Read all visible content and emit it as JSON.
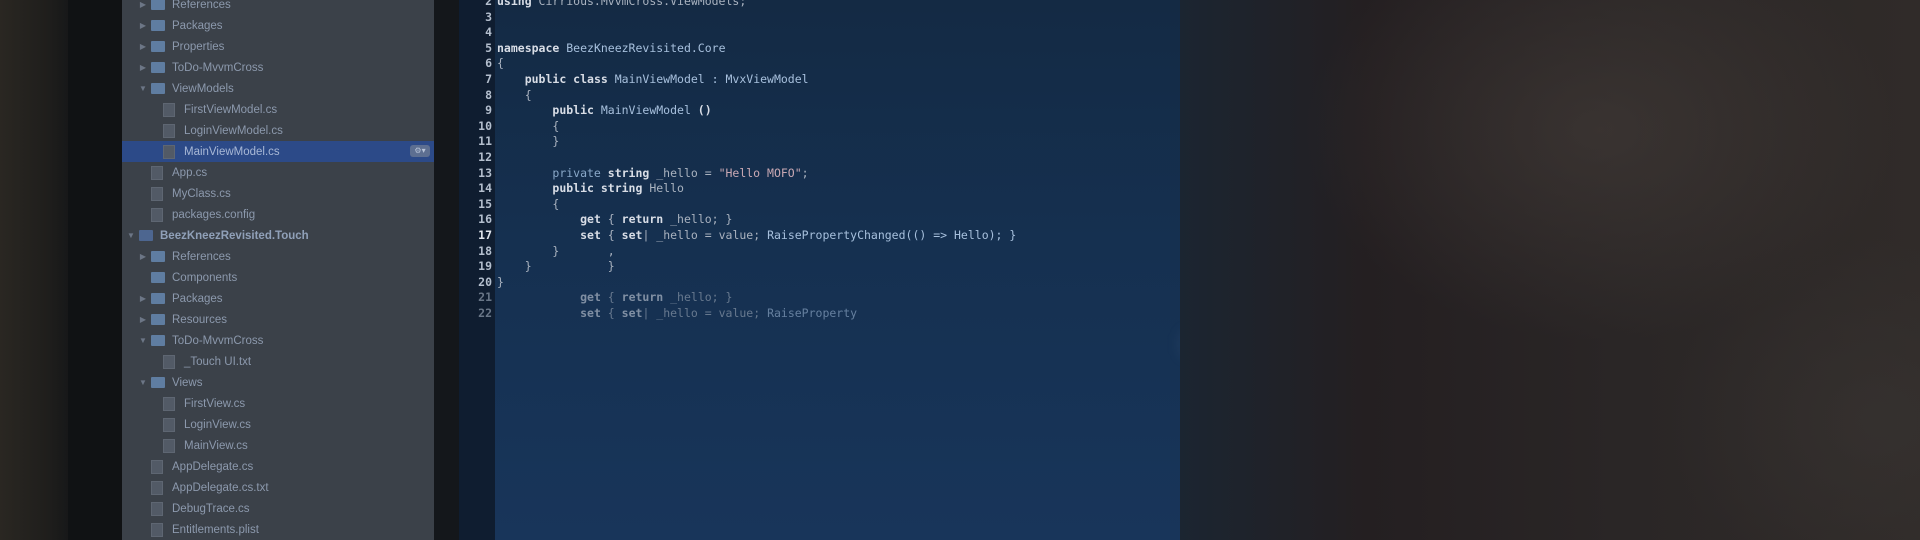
{
  "solution_explorer": {
    "items": [
      {
        "label": "References",
        "kind": "folder",
        "indent": 2,
        "arrow": "right"
      },
      {
        "label": "Packages",
        "kind": "folder",
        "indent": 2,
        "arrow": "right"
      },
      {
        "label": "Properties",
        "kind": "folder",
        "indent": 2,
        "arrow": "right"
      },
      {
        "label": "ToDo-MvvmCross",
        "kind": "folder",
        "indent": 2,
        "arrow": "right"
      },
      {
        "label": "ViewModels",
        "kind": "folder",
        "indent": 2,
        "arrow": "down"
      },
      {
        "label": "FirstViewModel.cs",
        "kind": "file",
        "indent": 3,
        "arrow": "none"
      },
      {
        "label": "LoginViewModel.cs",
        "kind": "file",
        "indent": 3,
        "arrow": "none"
      },
      {
        "label": "MainViewModel.cs",
        "kind": "file",
        "indent": 3,
        "arrow": "none",
        "selected": true
      },
      {
        "label": "App.cs",
        "kind": "file",
        "indent": 2,
        "arrow": "none"
      },
      {
        "label": "MyClass.cs",
        "kind": "file",
        "indent": 2,
        "arrow": "none"
      },
      {
        "label": "packages.config",
        "kind": "file",
        "indent": 2,
        "arrow": "none"
      },
      {
        "label": "BeezKneezRevisited.Touch",
        "kind": "project",
        "indent": 1,
        "arrow": "down"
      },
      {
        "label": "References",
        "kind": "folder",
        "indent": 2,
        "arrow": "right"
      },
      {
        "label": "Components",
        "kind": "folder",
        "indent": 2,
        "arrow": "none"
      },
      {
        "label": "Packages",
        "kind": "folder",
        "indent": 2,
        "arrow": "right"
      },
      {
        "label": "Resources",
        "kind": "folder",
        "indent": 2,
        "arrow": "right"
      },
      {
        "label": "ToDo-MvvmCross",
        "kind": "folder",
        "indent": 2,
        "arrow": "down"
      },
      {
        "label": "_Touch UI.txt",
        "kind": "file",
        "indent": 3,
        "arrow": "none"
      },
      {
        "label": "Views",
        "kind": "folder",
        "indent": 2,
        "arrow": "down"
      },
      {
        "label": "FirstView.cs",
        "kind": "file",
        "indent": 3,
        "arrow": "none"
      },
      {
        "label": "LoginView.cs",
        "kind": "file",
        "indent": 3,
        "arrow": "none"
      },
      {
        "label": "MainView.cs",
        "kind": "file",
        "indent": 3,
        "arrow": "none"
      },
      {
        "label": "AppDelegate.cs",
        "kind": "file",
        "indent": 2,
        "arrow": "none"
      },
      {
        "label": "AppDelegate.cs.txt",
        "kind": "file",
        "indent": 2,
        "arrow": "none"
      },
      {
        "label": "DebugTrace.cs",
        "kind": "file",
        "indent": 2,
        "arrow": "none"
      },
      {
        "label": "Entitlements.plist",
        "kind": "file",
        "indent": 2,
        "arrow": "none"
      }
    ],
    "selected_badge": "⚙▾"
  },
  "editor": {
    "lines": [
      {
        "n": "2",
        "segs": [
          [
            "k",
            "using "
          ],
          [
            "txt",
            "Cirrious.MvvmCross.ViewModels;"
          ]
        ]
      },
      {
        "n": "3",
        "segs": []
      },
      {
        "n": "4",
        "segs": []
      },
      {
        "n": "5",
        "segs": [
          [
            "k",
            "namespace "
          ],
          [
            "t",
            "BeezKneezRevisited.Core"
          ]
        ]
      },
      {
        "n": "6",
        "segs": [
          [
            "txt",
            "{"
          ]
        ]
      },
      {
        "n": "7",
        "segs": [
          [
            "txt",
            "    "
          ],
          [
            "k",
            "public class "
          ],
          [
            "t",
            "MainViewModel : MvxViewModel"
          ]
        ]
      },
      {
        "n": "8",
        "segs": [
          [
            "txt",
            "    {"
          ]
        ]
      },
      {
        "n": "9",
        "segs": [
          [
            "txt",
            "        "
          ],
          [
            "k",
            "public "
          ],
          [
            "t",
            "MainViewModel "
          ],
          [
            "k",
            "()"
          ]
        ]
      },
      {
        "n": "10",
        "segs": [
          [
            "txt",
            "        {"
          ]
        ]
      },
      {
        "n": "11",
        "segs": [
          [
            "txt",
            "        }"
          ]
        ]
      },
      {
        "n": "12",
        "segs": []
      },
      {
        "n": "13",
        "segs": [
          [
            "txt",
            "        "
          ],
          [
            "c",
            "private "
          ],
          [
            "k",
            "string "
          ],
          [
            "txt",
            "_hello = "
          ],
          [
            "s",
            "\"Hello MOFO\""
          ],
          [
            "txt",
            ";"
          ]
        ]
      },
      {
        "n": "14",
        "segs": [
          [
            "txt",
            "        "
          ],
          [
            "k",
            "public string "
          ],
          [
            "txt",
            "Hello"
          ]
        ]
      },
      {
        "n": "15",
        "segs": [
          [
            "txt",
            "        {"
          ]
        ]
      },
      {
        "n": "16",
        "segs": [
          [
            "txt",
            "            "
          ],
          [
            "k",
            "get "
          ],
          [
            "txt",
            "{ "
          ],
          [
            "k",
            "return "
          ],
          [
            "txt",
            "_hello; }"
          ]
        ]
      },
      {
        "n": "17",
        "hl": true,
        "segs": [
          [
            "txt",
            "            "
          ],
          [
            "k",
            "set "
          ],
          [
            "txt",
            "{ "
          ],
          [
            "k",
            "set"
          ],
          [
            "txt",
            "| _hello = value; "
          ],
          [
            "t",
            "RaisePropertyChanged(() => Hello); }"
          ]
        ]
      },
      {
        "n": "18",
        "segs": [
          [
            "txt",
            "        }       ,"
          ]
        ]
      },
      {
        "n": "19",
        "segs": [
          [
            "txt",
            "    }           }"
          ]
        ]
      },
      {
        "n": "20",
        "segs": [
          [
            "txt",
            "}"
          ]
        ]
      },
      {
        "n": "21",
        "segs": [
          [
            "txt",
            "            "
          ],
          [
            "k",
            "get "
          ],
          [
            "txt",
            "{ "
          ],
          [
            "k",
            "return "
          ],
          [
            "txt",
            "_hello; }"
          ]
        ]
      },
      {
        "n": "22",
        "segs": [
          [
            "txt",
            "            "
          ],
          [
            "k",
            "set "
          ],
          [
            "txt",
            "{ "
          ],
          [
            "k",
            "set"
          ],
          [
            "txt",
            "| _hello = value; "
          ],
          [
            "t",
            "RaiseProperty"
          ]
        ]
      }
    ]
  }
}
